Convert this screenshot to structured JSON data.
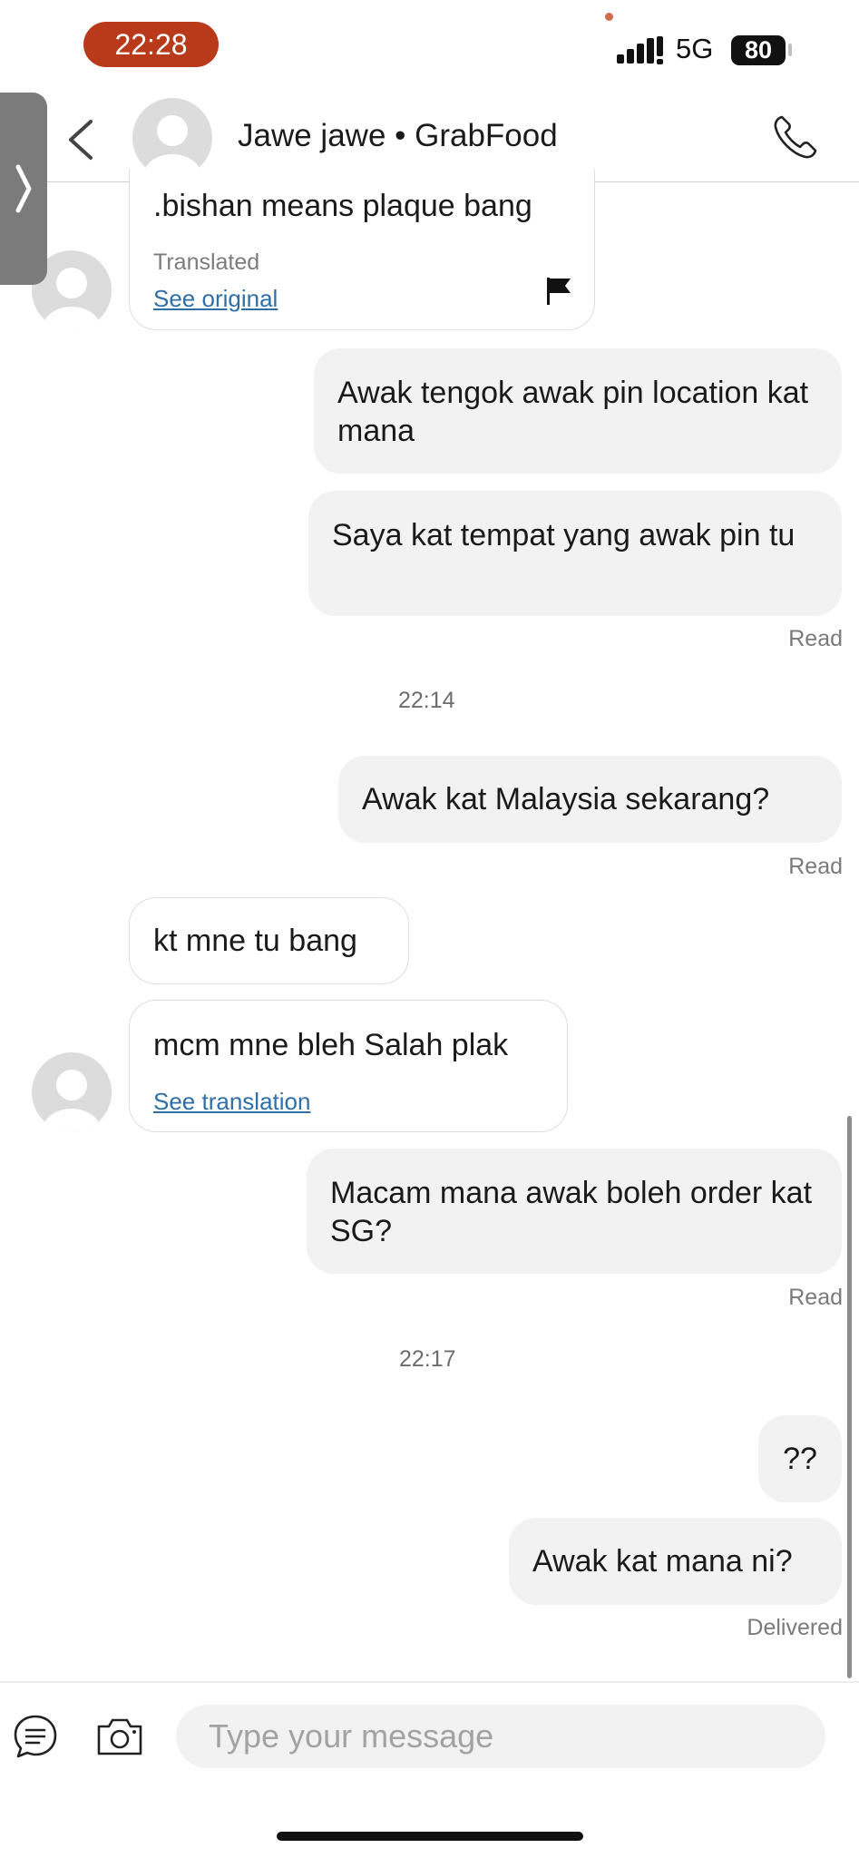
{
  "status_bar": {
    "time": "22:28",
    "network": "5G",
    "battery": "80"
  },
  "header": {
    "contact_name": "Jawe jawe • GrabFood",
    "back_icon": "chevron-left-icon",
    "call_icon": "phone-icon"
  },
  "messages": [
    {
      "direction": "incoming",
      "text": ".bishan means plaque bang",
      "translated_label": "Translated",
      "see_original": "See original",
      "report_icon": "flag-icon"
    },
    {
      "direction": "outgoing",
      "text": "Awak tengok awak pin location kat mana"
    },
    {
      "direction": "outgoing",
      "text": "Saya kat tempat yang awak pin tu",
      "status": "Read"
    },
    {
      "direction": "timestamp",
      "text": "22:14"
    },
    {
      "direction": "outgoing",
      "text": "Awak kat Malaysia sekarang?",
      "status": "Read"
    },
    {
      "direction": "incoming",
      "text": "kt mne tu bang"
    },
    {
      "direction": "incoming",
      "text": "mcm mne bleh Salah plak",
      "see_translation": "See translation"
    },
    {
      "direction": "outgoing",
      "text": "Macam mana awak boleh order kat SG?",
      "status": "Read"
    },
    {
      "direction": "timestamp",
      "text": "22:17"
    },
    {
      "direction": "outgoing",
      "text": "??"
    },
    {
      "direction": "outgoing",
      "text": "Awak kat mana ni?",
      "status": "Delivered"
    }
  ],
  "composer": {
    "placeholder": "Type your message",
    "quick_reply_icon": "chat-bubble-icon",
    "camera_icon": "camera-icon"
  }
}
